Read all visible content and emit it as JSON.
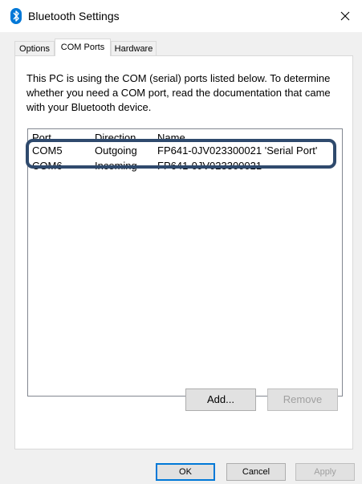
{
  "window": {
    "title": "Bluetooth Settings",
    "close_glyph": "✕"
  },
  "tabs": [
    {
      "label": "Options"
    },
    {
      "label": "COM Ports",
      "active": true
    },
    {
      "label": "Hardware"
    }
  ],
  "panel": {
    "description": "This PC is using the COM (serial) ports listed below. To determine whether you need a COM port, read the documentation that came with your Bluetooth device.",
    "list": {
      "columns": [
        "Port",
        "Direction",
        "Name"
      ],
      "rows": [
        {
          "port": "COM5",
          "direction": "Outgoing",
          "name": "FP641-0JV023300021 'Serial Port'"
        },
        {
          "port": "COM6",
          "direction": "Incoming",
          "name": "FP641-0JV023300021"
        }
      ]
    },
    "add_label": "Add...",
    "remove_label": "Remove"
  },
  "footer": {
    "ok_label": "OK",
    "cancel_label": "Cancel",
    "apply_label": "Apply"
  },
  "icons": {
    "title": "bluetooth-icon",
    "close": "close-icon"
  },
  "colors": {
    "highlight_border": "#2f4a6d",
    "bluetooth_blue": "#0078d7"
  }
}
